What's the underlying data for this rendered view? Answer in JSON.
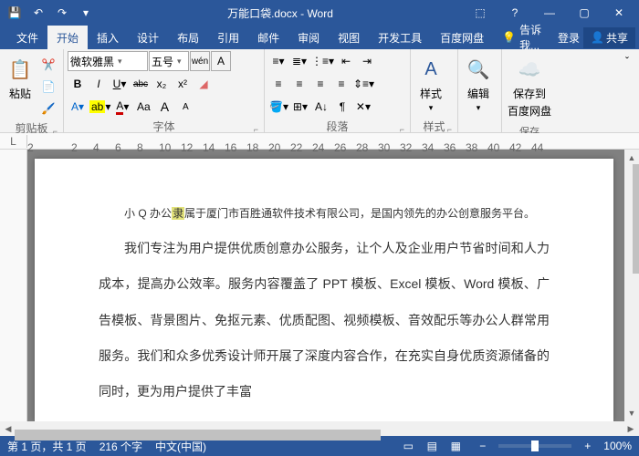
{
  "title": "万能口袋.docx - Word",
  "qat": {
    "save": "💾",
    "undo": "↶",
    "redo": "↷",
    "more": "▾"
  },
  "wincontrols": {
    "help": "?",
    "min": "—",
    "max": "▢",
    "close": "✕",
    "opts": "⬚"
  },
  "tabs": [
    "文件",
    "开始",
    "插入",
    "设计",
    "布局",
    "引用",
    "邮件",
    "审阅",
    "视图",
    "开发工具",
    "百度网盘"
  ],
  "activeTab": 1,
  "tellme": "告诉我...",
  "login": "登录",
  "share": "共享",
  "ribbon": {
    "clipboard": {
      "label": "剪贴板",
      "paste": "粘贴"
    },
    "font": {
      "label": "字体",
      "family": "微软雅黑",
      "size": "五号",
      "bold": "B",
      "italic": "I",
      "underline": "U",
      "strike": "abc",
      "sub": "x₂",
      "sup": "x²",
      "clear": "◢",
      "phonetic": "wén",
      "border": "A",
      "highlight": "ab",
      "color": "A",
      "case": "Aa",
      "grow": "A",
      "shrink": "A"
    },
    "para": {
      "label": "段落"
    },
    "styles": {
      "label": "样式",
      "btn": "样式"
    },
    "edit": {
      "label": "",
      "btn": "编辑"
    },
    "baidu": {
      "label": "保存",
      "btn": "保存到",
      "btn2": "百度网盘"
    }
  },
  "ruler": [
    "2",
    "",
    "2",
    "4",
    "6",
    "8",
    "10",
    "12",
    "14",
    "16",
    "18",
    "20",
    "22",
    "24",
    "26",
    "28",
    "30",
    "32",
    "34",
    "36",
    "38",
    "40",
    "42",
    "44"
  ],
  "doc": {
    "p1_a": "小 Q 办公",
    "p1_hl": "隶",
    "p1_b": "属于厦门市百胜通软件技术有限公司，是国内领先的办公创意服务平台。",
    "p2": "我们专注为用户提供优质创意办公服务，让个人及企业用户节省时间和人力成本，提高办公效率。服务内容覆盖了 PPT 模板、Excel 模板、Word 模板、广告模板、背景图片、免抠元素、优质配图、视频模板、音效配乐等办公人群常用服务。我们和众多优秀设计师开展了深度内容合作，在充实自身优质资源储备的同时，更为用户提供了丰富"
  },
  "status": {
    "page": "第 1 页，共 1 页",
    "words": "216 个字",
    "lang": "中文(中国)",
    "ins": "",
    "zoom": "100%",
    "minus": "−",
    "plus": "+"
  }
}
